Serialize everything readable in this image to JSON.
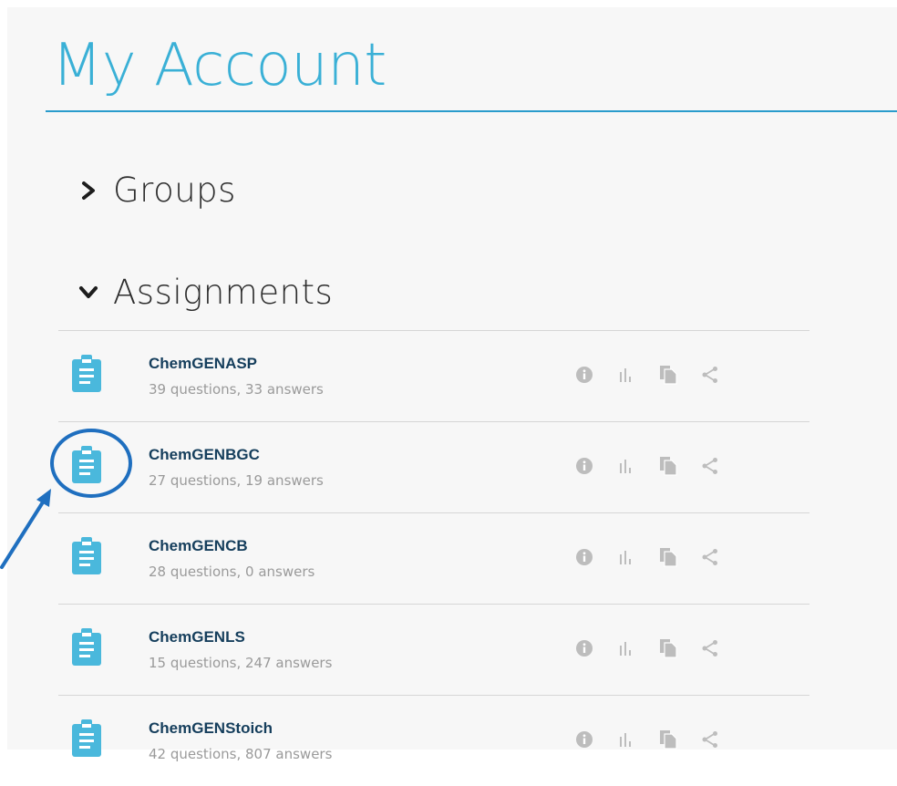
{
  "page": {
    "title": "My Account"
  },
  "sections": {
    "groups": {
      "label": "Groups",
      "state": "collapsed",
      "icon": "chevron-right-icon"
    },
    "assignments": {
      "label": "Assignments",
      "state": "expanded",
      "icon": "chevron-down-icon"
    }
  },
  "assignments": [
    {
      "name": "ChemGENASP",
      "meta": "39 questions, 33 answers"
    },
    {
      "name": "ChemGENBGC",
      "meta": "27 questions, 19 answers"
    },
    {
      "name": "ChemGENCB",
      "meta": "28 questions, 0 answers"
    },
    {
      "name": "ChemGENLS",
      "meta": "15 questions, 247 answers"
    },
    {
      "name": "ChemGENStoich",
      "meta": "42 questions, 807 answers"
    }
  ],
  "row_actions": [
    "info-icon",
    "stats-icon",
    "copy-icon",
    "share-icon"
  ],
  "colors": {
    "accent": "#3ab0d6",
    "rule": "#2a9ccc",
    "name_text": "#153e5c",
    "meta_text": "#9a9a9a",
    "action_icon": "#bdbdbd",
    "annotation": "#1f6fbf"
  }
}
